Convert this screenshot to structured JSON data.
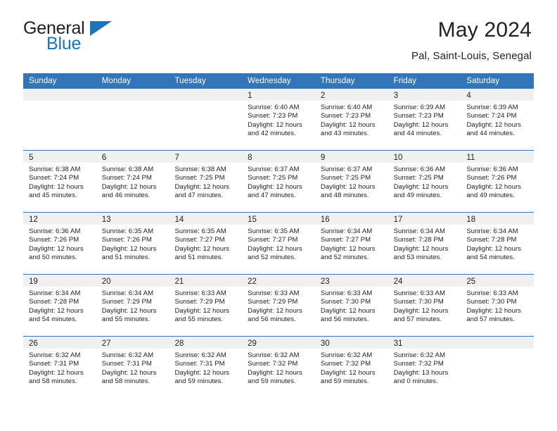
{
  "brand": {
    "name_part1": "General",
    "name_part2": "Blue",
    "accent_color": "#1b75bb"
  },
  "header": {
    "title": "May 2024",
    "location": "Pal, Saint-Louis, Senegal"
  },
  "theme": {
    "header_band_color": "#3275b8",
    "day_band_color": "#f0f0f0",
    "text_color": "#222222"
  },
  "weekdays": [
    "Sunday",
    "Monday",
    "Tuesday",
    "Wednesday",
    "Thursday",
    "Friday",
    "Saturday"
  ],
  "weeks": [
    [
      {
        "day": "",
        "lines": []
      },
      {
        "day": "",
        "lines": []
      },
      {
        "day": "",
        "lines": []
      },
      {
        "day": "1",
        "lines": [
          "Sunrise: 6:40 AM",
          "Sunset: 7:23 PM",
          "Daylight: 12 hours",
          "and 42 minutes."
        ]
      },
      {
        "day": "2",
        "lines": [
          "Sunrise: 6:40 AM",
          "Sunset: 7:23 PM",
          "Daylight: 12 hours",
          "and 43 minutes."
        ]
      },
      {
        "day": "3",
        "lines": [
          "Sunrise: 6:39 AM",
          "Sunset: 7:23 PM",
          "Daylight: 12 hours",
          "and 44 minutes."
        ]
      },
      {
        "day": "4",
        "lines": [
          "Sunrise: 6:39 AM",
          "Sunset: 7:24 PM",
          "Daylight: 12 hours",
          "and 44 minutes."
        ]
      }
    ],
    [
      {
        "day": "5",
        "lines": [
          "Sunrise: 6:38 AM",
          "Sunset: 7:24 PM",
          "Daylight: 12 hours",
          "and 45 minutes."
        ]
      },
      {
        "day": "6",
        "lines": [
          "Sunrise: 6:38 AM",
          "Sunset: 7:24 PM",
          "Daylight: 12 hours",
          "and 46 minutes."
        ]
      },
      {
        "day": "7",
        "lines": [
          "Sunrise: 6:38 AM",
          "Sunset: 7:25 PM",
          "Daylight: 12 hours",
          "and 47 minutes."
        ]
      },
      {
        "day": "8",
        "lines": [
          "Sunrise: 6:37 AM",
          "Sunset: 7:25 PM",
          "Daylight: 12 hours",
          "and 47 minutes."
        ]
      },
      {
        "day": "9",
        "lines": [
          "Sunrise: 6:37 AM",
          "Sunset: 7:25 PM",
          "Daylight: 12 hours",
          "and 48 minutes."
        ]
      },
      {
        "day": "10",
        "lines": [
          "Sunrise: 6:36 AM",
          "Sunset: 7:25 PM",
          "Daylight: 12 hours",
          "and 49 minutes."
        ]
      },
      {
        "day": "11",
        "lines": [
          "Sunrise: 6:36 AM",
          "Sunset: 7:26 PM",
          "Daylight: 12 hours",
          "and 49 minutes."
        ]
      }
    ],
    [
      {
        "day": "12",
        "lines": [
          "Sunrise: 6:36 AM",
          "Sunset: 7:26 PM",
          "Daylight: 12 hours",
          "and 50 minutes."
        ]
      },
      {
        "day": "13",
        "lines": [
          "Sunrise: 6:35 AM",
          "Sunset: 7:26 PM",
          "Daylight: 12 hours",
          "and 51 minutes."
        ]
      },
      {
        "day": "14",
        "lines": [
          "Sunrise: 6:35 AM",
          "Sunset: 7:27 PM",
          "Daylight: 12 hours",
          "and 51 minutes."
        ]
      },
      {
        "day": "15",
        "lines": [
          "Sunrise: 6:35 AM",
          "Sunset: 7:27 PM",
          "Daylight: 12 hours",
          "and 52 minutes."
        ]
      },
      {
        "day": "16",
        "lines": [
          "Sunrise: 6:34 AM",
          "Sunset: 7:27 PM",
          "Daylight: 12 hours",
          "and 52 minutes."
        ]
      },
      {
        "day": "17",
        "lines": [
          "Sunrise: 6:34 AM",
          "Sunset: 7:28 PM",
          "Daylight: 12 hours",
          "and 53 minutes."
        ]
      },
      {
        "day": "18",
        "lines": [
          "Sunrise: 6:34 AM",
          "Sunset: 7:28 PM",
          "Daylight: 12 hours",
          "and 54 minutes."
        ]
      }
    ],
    [
      {
        "day": "19",
        "lines": [
          "Sunrise: 6:34 AM",
          "Sunset: 7:28 PM",
          "Daylight: 12 hours",
          "and 54 minutes."
        ]
      },
      {
        "day": "20",
        "lines": [
          "Sunrise: 6:34 AM",
          "Sunset: 7:29 PM",
          "Daylight: 12 hours",
          "and 55 minutes."
        ]
      },
      {
        "day": "21",
        "lines": [
          "Sunrise: 6:33 AM",
          "Sunset: 7:29 PM",
          "Daylight: 12 hours",
          "and 55 minutes."
        ]
      },
      {
        "day": "22",
        "lines": [
          "Sunrise: 6:33 AM",
          "Sunset: 7:29 PM",
          "Daylight: 12 hours",
          "and 56 minutes."
        ]
      },
      {
        "day": "23",
        "lines": [
          "Sunrise: 6:33 AM",
          "Sunset: 7:30 PM",
          "Daylight: 12 hours",
          "and 56 minutes."
        ]
      },
      {
        "day": "24",
        "lines": [
          "Sunrise: 6:33 AM",
          "Sunset: 7:30 PM",
          "Daylight: 12 hours",
          "and 57 minutes."
        ]
      },
      {
        "day": "25",
        "lines": [
          "Sunrise: 6:33 AM",
          "Sunset: 7:30 PM",
          "Daylight: 12 hours",
          "and 57 minutes."
        ]
      }
    ],
    [
      {
        "day": "26",
        "lines": [
          "Sunrise: 6:32 AM",
          "Sunset: 7:31 PM",
          "Daylight: 12 hours",
          "and 58 minutes."
        ]
      },
      {
        "day": "27",
        "lines": [
          "Sunrise: 6:32 AM",
          "Sunset: 7:31 PM",
          "Daylight: 12 hours",
          "and 58 minutes."
        ]
      },
      {
        "day": "28",
        "lines": [
          "Sunrise: 6:32 AM",
          "Sunset: 7:31 PM",
          "Daylight: 12 hours",
          "and 59 minutes."
        ]
      },
      {
        "day": "29",
        "lines": [
          "Sunrise: 6:32 AM",
          "Sunset: 7:32 PM",
          "Daylight: 12 hours",
          "and 59 minutes."
        ]
      },
      {
        "day": "30",
        "lines": [
          "Sunrise: 6:32 AM",
          "Sunset: 7:32 PM",
          "Daylight: 12 hours",
          "and 59 minutes."
        ]
      },
      {
        "day": "31",
        "lines": [
          "Sunrise: 6:32 AM",
          "Sunset: 7:32 PM",
          "Daylight: 13 hours",
          "and 0 minutes."
        ]
      },
      {
        "day": "",
        "lines": []
      }
    ]
  ]
}
